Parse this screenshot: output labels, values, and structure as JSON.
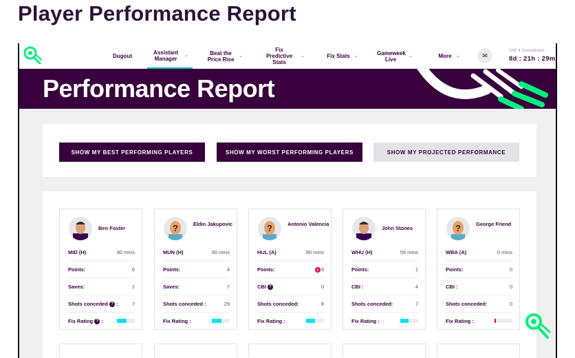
{
  "page_title": "Player Performance Report",
  "nav": {
    "items": [
      {
        "label": "Dugout",
        "chevron": false,
        "active": false
      },
      {
        "label": "Assistant Manager",
        "chevron": true,
        "active": true
      },
      {
        "label": "Beat the Price Rise",
        "chevron": true,
        "active": false
      },
      {
        "label": "Fix Predictive Stats",
        "chevron": true,
        "active": false
      },
      {
        "label": "Fix Stats",
        "chevron": true,
        "active": false
      },
      {
        "label": "Gameweek Live",
        "chevron": true,
        "active": false
      },
      {
        "label": "More",
        "chevron": true,
        "active": false
      }
    ],
    "countdown_label": "GW 4 Countdown",
    "countdown_value": "8d : 21h : 29m",
    "mail_icon": "mail-icon"
  },
  "hero": {
    "title": "Performance Report"
  },
  "buttons": {
    "best": "SHOW MY BEST PERFORMING PLAYERS",
    "worst": "SHOW MY WORST PERFORMING PLAYERS",
    "projected": "SHOW MY PROJECTED PERFORMANCE"
  },
  "colors": {
    "brand": "#37003c",
    "accent": "#00e5f0",
    "green": "#05f07b",
    "pink": "#e90052"
  },
  "players": [
    {
      "name": "Ben Foster",
      "team": "MID (H)",
      "mins": "90 mins",
      "points_label": "Points:",
      "points": "6",
      "hot": false,
      "stat2_label": "Saves:",
      "stat2_value": "2",
      "stat2_help": false,
      "stat3_label": "Shots conceded",
      "stat3_value": "7",
      "stat3_help": true,
      "fix_label": "Fix Rating",
      "fix_help": true,
      "fix_rating": 0.55,
      "fix_color": "cyan",
      "avatar": "player-photo"
    },
    {
      "name": "Eldin Jakupovic",
      "team": "MUN (H)",
      "mins": "90 mins",
      "points_label": "Points:",
      "points": "4",
      "hot": false,
      "stat2_label": "Saves:",
      "stat2_value": "7",
      "stat2_help": false,
      "stat3_label": "Shots conceded :",
      "stat3_value": "29",
      "stat3_help": false,
      "fix_label": "Fix Rating :",
      "fix_help": false,
      "fix_rating": 0.55,
      "fix_color": "cyan",
      "avatar": "unknown-player"
    },
    {
      "name": "Antonio Valencia",
      "team": "HUL (A)",
      "mins": "90 mins",
      "points_label": "Points:",
      "points": "9",
      "hot": true,
      "stat2_label": "CBI",
      "stat2_value": "0",
      "stat2_help": true,
      "stat3_label": "Shots conceded:",
      "stat3_value": "8",
      "stat3_help": false,
      "fix_label": "Fix Rating :",
      "fix_help": false,
      "fix_rating": 0.5,
      "fix_color": "cyan",
      "avatar": "unknown-player"
    },
    {
      "name": "John Stones",
      "team": "WHU (H)",
      "mins": "59 mins",
      "points_label": "Points:",
      "points": "1",
      "hot": false,
      "stat2_label": "CBI :",
      "stat2_value": "4",
      "stat2_help": false,
      "stat3_label": "Shots conceded:",
      "stat3_value": "7",
      "stat3_help": false,
      "fix_label": "Fix Rating :",
      "fix_help": false,
      "fix_rating": 0.45,
      "fix_color": "cyan",
      "avatar": "player-photo"
    },
    {
      "name": "George Friend",
      "team": "WBA (A)",
      "mins": "0 mins",
      "points_label": "Points:",
      "points": "0",
      "hot": false,
      "stat2_label": "CBI :",
      "stat2_value": "0",
      "stat2_help": false,
      "stat3_label": "Shots conceded:",
      "stat3_value": "0",
      "stat3_help": false,
      "fix_label": "Fix Rating :",
      "fix_help": false,
      "fix_rating": 0.06,
      "fix_color": "red",
      "avatar": "unknown-player"
    }
  ]
}
